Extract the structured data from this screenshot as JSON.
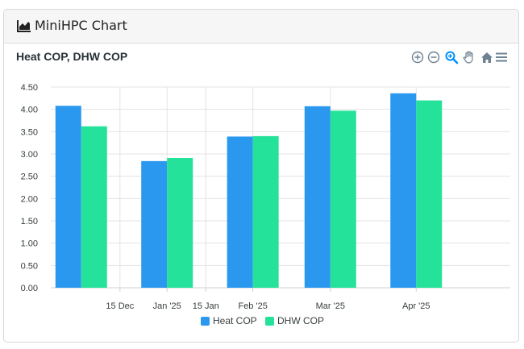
{
  "card": {
    "title": "MiniHPC Chart",
    "title_icon": "area-chart-icon"
  },
  "toolbar": {
    "icons": [
      "zoom-in-icon",
      "zoom-out-icon",
      "magnifier-icon",
      "pan-hand-icon",
      "home-icon",
      "menu-icon"
    ]
  },
  "colors": {
    "heat": "#2b98f0",
    "dhw": "#25e29a",
    "grid": "#e3e3e3",
    "zoom_active": "#008ffb",
    "toolbar_icon": "#6e8192"
  },
  "chart_data": {
    "type": "bar",
    "title": "Heat COP, DHW COP",
    "xlabel": "",
    "ylabel": "",
    "ylim": [
      0,
      4.5
    ],
    "y_ticks": [
      "4.50",
      "4.00",
      "3.50",
      "3.00",
      "2.50",
      "2.00",
      "1.50",
      "1.00",
      "0.50",
      "0.00"
    ],
    "x_ticks": [
      "15 Dec",
      "Jan '25",
      "15 Jan",
      "Feb '25",
      "Mar '25",
      "Apr '25"
    ],
    "x_tick_dates": [
      "2024-12-15",
      "2025-01-01",
      "2025-01-15",
      "2025-02-01",
      "2025-03-01",
      "2025-04-01"
    ],
    "x_range": [
      "2024-11-20",
      "2025-05-05"
    ],
    "categories": [
      "2024-12-01",
      "2025-01-01",
      "2025-02-01",
      "2025-03-01",
      "2025-04-01"
    ],
    "series": [
      {
        "name": "Heat COP",
        "values": [
          4.08,
          2.84,
          3.39,
          4.07,
          4.36
        ]
      },
      {
        "name": "DHW COP",
        "values": [
          3.62,
          2.91,
          3.4,
          3.97,
          4.2
        ]
      }
    ],
    "grid": true,
    "legend_position": "bottom"
  }
}
